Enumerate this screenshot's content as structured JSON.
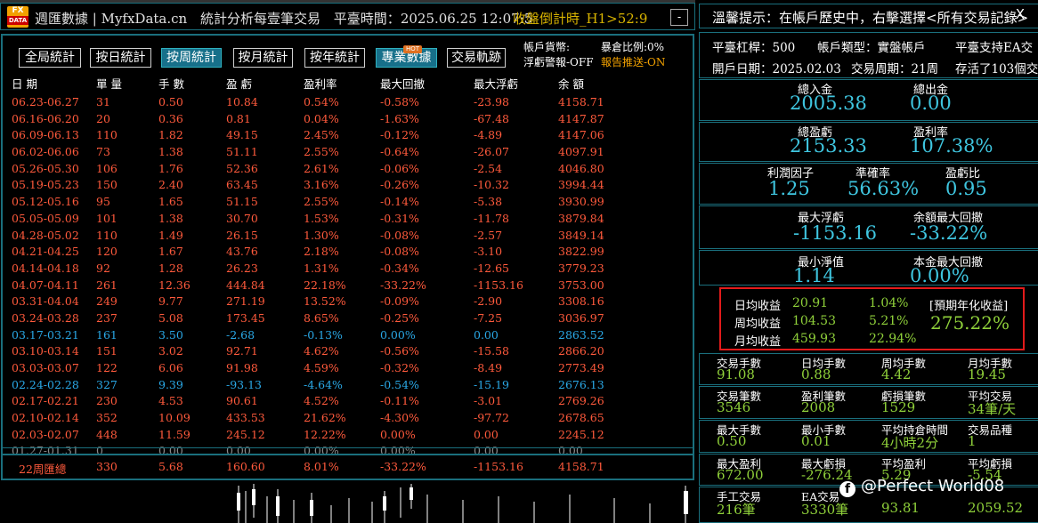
{
  "titlebar": {
    "logo_top": "FX",
    "logo_bottom": "DATA",
    "brand": "週匯數據 | MyfxData.cn",
    "title": "統計分析每壹筆交易",
    "server_time_label": "平臺時間：",
    "server_time": "2025.06.25 12:07:5",
    "countdown": "收盤倒計時_H1>52:9",
    "minimize": "-"
  },
  "tabs": [
    "全局統計",
    "按日統計",
    "按周統計",
    "按月統計",
    "按年統計",
    "專業數據",
    "交易軌跡"
  ],
  "active_tab": "按周統計",
  "hot_badge": "HOT",
  "account": {
    "currency_label": "帳戶貨幣:",
    "currency_value": "",
    "exposure": "暴倉比例:0%",
    "floating_alert": "浮虧警報-OFF",
    "report_push": "報告推送-ON"
  },
  "table": {
    "headers": [
      "日 期",
      "單 量",
      "手 數",
      "盈 虧",
      "盈利率",
      "最大回撤",
      "最大浮虧",
      "余 額"
    ],
    "rows": [
      {
        "cells": [
          "06.23-06.27",
          "31",
          "0.50",
          "10.84",
          "0.54%",
          "-0.58%",
          "-23.98",
          "4158.71"
        ],
        "state": "up"
      },
      {
        "cells": [
          "06.16-06.20",
          "20",
          "0.36",
          "0.81",
          "0.04%",
          "-1.63%",
          "-67.48",
          "4147.87"
        ],
        "state": "up"
      },
      {
        "cells": [
          "06.09-06.13",
          "110",
          "1.82",
          "49.15",
          "2.45%",
          "-0.12%",
          "-4.89",
          "4147.06"
        ],
        "state": "up"
      },
      {
        "cells": [
          "06.02-06.06",
          "73",
          "1.38",
          "51.11",
          "2.55%",
          "-0.64%",
          "-26.07",
          "4097.91"
        ],
        "state": "up"
      },
      {
        "cells": [
          "05.26-05.30",
          "106",
          "1.76",
          "52.36",
          "2.61%",
          "-0.06%",
          "-2.54",
          "4046.80"
        ],
        "state": "up"
      },
      {
        "cells": [
          "05.19-05.23",
          "150",
          "2.40",
          "63.45",
          "3.16%",
          "-0.26%",
          "-10.32",
          "3994.44"
        ],
        "state": "up"
      },
      {
        "cells": [
          "05.12-05.16",
          "95",
          "1.65",
          "51.15",
          "2.55%",
          "-0.14%",
          "-5.38",
          "3930.99"
        ],
        "state": "up"
      },
      {
        "cells": [
          "05.05-05.09",
          "101",
          "1.38",
          "30.70",
          "1.53%",
          "-0.31%",
          "-11.78",
          "3879.84"
        ],
        "state": "up"
      },
      {
        "cells": [
          "04.28-05.02",
          "110",
          "1.49",
          "26.15",
          "1.30%",
          "-0.08%",
          "-2.57",
          "3849.14"
        ],
        "state": "up"
      },
      {
        "cells": [
          "04.21-04.25",
          "120",
          "1.67",
          "43.76",
          "2.18%",
          "-0.08%",
          "-3.10",
          "3822.99"
        ],
        "state": "up"
      },
      {
        "cells": [
          "04.14-04.18",
          "92",
          "1.28",
          "26.23",
          "1.31%",
          "-0.34%",
          "-12.65",
          "3779.23"
        ],
        "state": "up"
      },
      {
        "cells": [
          "04.07-04.11",
          "261",
          "12.36",
          "444.84",
          "22.18%",
          "-33.22%",
          "-1153.16",
          "3753.00"
        ],
        "state": "up"
      },
      {
        "cells": [
          "03.31-04.04",
          "249",
          "9.77",
          "271.19",
          "13.52%",
          "-0.09%",
          "-2.90",
          "3308.16"
        ],
        "state": "up"
      },
      {
        "cells": [
          "03.24-03.28",
          "237",
          "5.08",
          "173.45",
          "8.65%",
          "-0.25%",
          "-7.25",
          "3036.97"
        ],
        "state": "up"
      },
      {
        "cells": [
          "03.17-03.21",
          "161",
          "3.50",
          "-2.68",
          "-0.13%",
          "0.00%",
          "0.00",
          "2863.52"
        ],
        "state": "down"
      },
      {
        "cells": [
          "03.10-03.14",
          "151",
          "3.02",
          "92.71",
          "4.62%",
          "-0.56%",
          "-15.58",
          "2866.20"
        ],
        "state": "up"
      },
      {
        "cells": [
          "03.03-03.07",
          "122",
          "6.06",
          "91.98",
          "4.59%",
          "-0.32%",
          "-8.49",
          "2773.49"
        ],
        "state": "up"
      },
      {
        "cells": [
          "02.24-02.28",
          "327",
          "9.39",
          "-93.13",
          "-4.64%",
          "-0.54%",
          "-15.19",
          "2676.13"
        ],
        "state": "down"
      },
      {
        "cells": [
          "02.17-02.21",
          "230",
          "4.53",
          "90.61",
          "4.52%",
          "-0.11%",
          "-3.01",
          "2769.26"
        ],
        "state": "up"
      },
      {
        "cells": [
          "02.10-02.14",
          "352",
          "10.09",
          "433.53",
          "21.62%",
          "-4.30%",
          "-97.72",
          "2678.65"
        ],
        "state": "up"
      },
      {
        "cells": [
          "02.03-02.07",
          "448",
          "11.59",
          "245.12",
          "12.22%",
          "0.00%",
          "0.00",
          "2245.12"
        ],
        "state": "up"
      },
      {
        "cells": [
          "01.27-01.31",
          "0",
          "0.00",
          "0.00",
          "0.00%",
          "0.00%",
          "0.00",
          "0.00"
        ],
        "state": "zero"
      }
    ],
    "summary": [
      "22周匯總",
      "330",
      "5.68",
      "160.60",
      "8.01%",
      "-33.22%",
      "-1153.16",
      "4158.71"
    ]
  },
  "right": {
    "tip": "溫馨提示：在帳戶歷史中，右擊選擇<所有交易記錄>",
    "tip_close": "X",
    "leverage": "平臺杠桿：500",
    "account_type": "帳戶類型：實盤帳戶",
    "ea_support": "平臺支持EA交",
    "open_date": "開戶日期：2025.02.03",
    "trade_period": "交易周期：21周",
    "ea_count": "存活了103個交",
    "deposit_label": "總入金",
    "deposit": "2005.38",
    "withdraw_label": "總出金",
    "withdraw": "0.00",
    "profit_label": "總盈虧",
    "profit": "2153.33",
    "profit_rate_label": "盈利率",
    "profit_rate": "107.38%",
    "factor_label": "利潤因子",
    "factor": "1.25",
    "accuracy_label": "準確率",
    "accuracy": "56.63%",
    "pl_ratio_label": "盈虧比",
    "pl_ratio": "0.95",
    "max_float_label": "最大浮虧",
    "max_float": "-1153.16",
    "max_dd_label": "余額最大回撤",
    "max_dd": "-33.22%",
    "min_equity_label": "最小淨值",
    "min_equity": "1.14",
    "principal_dd_label": "本金最大回撤",
    "principal_dd": "0.00%",
    "growth": {
      "daily_label": "日均收益",
      "daily": "20.91",
      "daily_pct": "1.04%",
      "weekly_label": "周均收益",
      "weekly": "104.53",
      "weekly_pct": "5.21%",
      "monthly_label": "月均收益",
      "monthly": "459.93",
      "monthly_pct": "22.94%",
      "annual_label": "[預期年化收益]",
      "annual": "275.22%"
    },
    "stats": [
      {
        "label": "交易手數",
        "value": "91.08"
      },
      {
        "label": "日均手數",
        "value": "0.88"
      },
      {
        "label": "周均手數",
        "value": "4.42"
      },
      {
        "label": "月均手數",
        "value": "19.45"
      },
      {
        "label": "交易筆數",
        "value": "3546"
      },
      {
        "label": "盈利筆數",
        "value": "2008"
      },
      {
        "label": "虧損筆數",
        "value": "1529"
      },
      {
        "label": "平均交易",
        "value": "34筆/天"
      },
      {
        "label": "最大手數",
        "value": "0.50"
      },
      {
        "label": "最小手數",
        "value": "0.01"
      },
      {
        "label": "平均持倉時間",
        "value": "4小時2分"
      },
      {
        "label": "交易品種",
        "value": "1"
      },
      {
        "label": "最大盈利",
        "value": "672.00"
      },
      {
        "label": "最大虧損",
        "value": "-276.24"
      },
      {
        "label": "平均盈利",
        "value": "5.29"
      },
      {
        "label": "平均虧損",
        "value": "-5.54"
      },
      {
        "label": "手工交易",
        "value": "216筆"
      },
      {
        "label": "EA交易",
        "value": "3330筆"
      },
      {
        "label": "",
        "value": "93.81"
      },
      {
        "label": "",
        "value": "2059.52"
      }
    ],
    "watermark": "@Perfect World08",
    "fb_icon_glyph": "f"
  },
  "colors": {
    "frame": "#1a6f7d",
    "profit": "#ff5a3c",
    "loss": "#2aa8e6",
    "value_cyan": "#3fc6e0",
    "value_green": "#8fd03a",
    "highlight_border": "#e21b1b",
    "accent_orange": "#f2a100"
  }
}
